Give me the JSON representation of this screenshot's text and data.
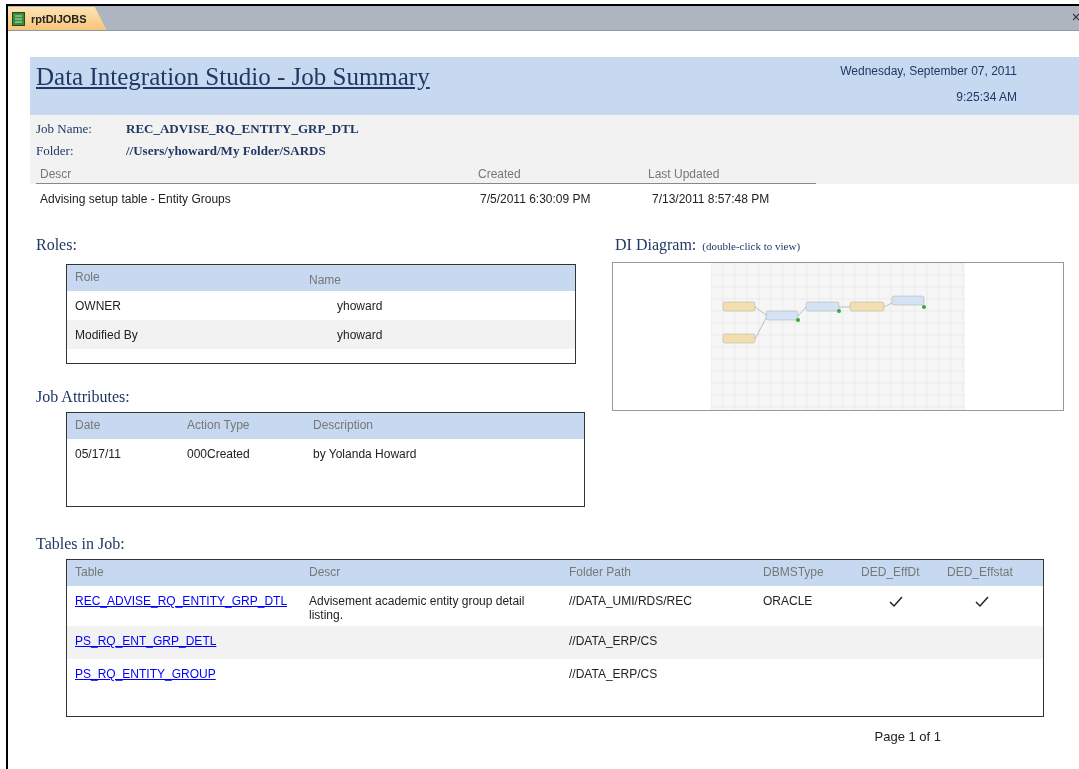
{
  "tab": {
    "label": "rptDIJOBS",
    "selected": true
  },
  "header": {
    "title": "Data Integration Studio - Job Summary",
    "date": "Wednesday, September 07, 2011",
    "time": "9:25:34 AM"
  },
  "job": {
    "name_label": "Job Name:",
    "name": "REC_ADVISE_RQ_ENTITY_GRP_DTL",
    "folder_label": "Folder:",
    "folder": "//Users/yhoward/My Folder/SARDS"
  },
  "summary": {
    "columns": [
      "Descr",
      "Created",
      "Last Updated"
    ],
    "row": [
      "Advising setup table - Entity Groups",
      "7/5/2011 6:30:09 PM",
      "7/13/2011 8:57:48 PM"
    ]
  },
  "roles": {
    "title": "Roles:",
    "columns": [
      "Role",
      "Name"
    ],
    "rows": [
      {
        "cells": [
          "OWNER",
          "yhoward"
        ]
      },
      {
        "cells": [
          "Modified By",
          "yhoward"
        ]
      }
    ]
  },
  "attributes": {
    "title": "Job Attributes:",
    "columns": [
      "Date",
      "Action Type",
      "Description"
    ],
    "rows": [
      {
        "cells": [
          "05/17/11",
          "000Created",
          "by Yolanda Howard"
        ]
      }
    ]
  },
  "diagram": {
    "title": "DI Diagram:",
    "hint": "(double-click to view)"
  },
  "tables": {
    "title": "Tables in Job:",
    "columns": [
      "Table",
      "Descr",
      "Folder Path",
      "DBMSType",
      "DED_EffDt",
      "DED_Effstat"
    ],
    "rows": [
      {
        "table": "REC_ADVISE_RQ_ENTITY_GRP_DTL",
        "descr": "Advisement academic entity group detail listing.",
        "folder": "//DATA_UMI/RDS/REC",
        "dbms": "ORACLE",
        "eff_dt": true,
        "eff_stat": true
      },
      {
        "table": "PS_RQ_ENT_GRP_DETL",
        "folder": "//DATA_ERP/CS",
        "eff_dt": false,
        "eff_stat": false
      },
      {
        "table": "PS_RQ_ENTITY_GROUP",
        "folder": "//DATA_ERP/CS",
        "eff_dt": false,
        "eff_stat": false
      }
    ]
  },
  "footer": {
    "page": "Page 1 of 1"
  }
}
